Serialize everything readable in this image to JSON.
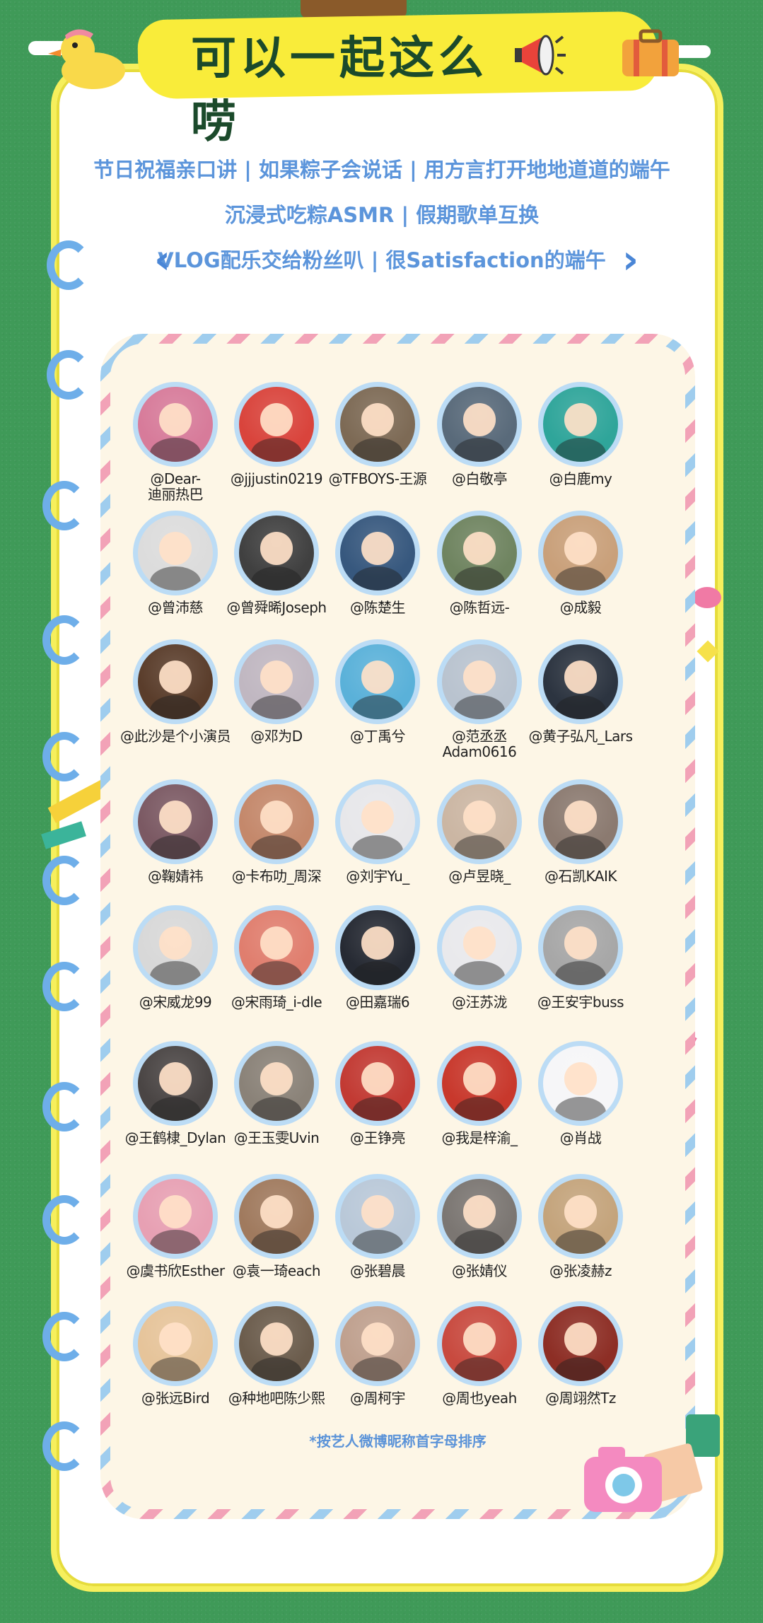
{
  "title": "可以一起这么唠",
  "topics": {
    "line1": "节日祝福亲口讲 | 如果粽子会说话 | 用方言打开地地道道的端午",
    "line2": "沉浸式吃粽ASMR | 假期歌单互换",
    "line3": "VLOG配乐交给粉丝叭 | 很Satisfaction的端午",
    "prev_icon": "‹",
    "next_icon": "›"
  },
  "artists": [
    {
      "name": "@Dear-\n迪丽热巴",
      "color": "#d77b9a"
    },
    {
      "name": "@jjjustin0219",
      "color": "#d9443c"
    },
    {
      "name": "@TFBOYS-王源",
      "color": "#7d6a55"
    },
    {
      "name": "@白敬亭",
      "color": "#596a7a"
    },
    {
      "name": "@白鹿my",
      "color": "#2fa59a"
    },
    {
      "name": "@曾沛慈",
      "color": "#dcdcdc"
    },
    {
      "name": "@曾舜晞Joseph",
      "color": "#404040"
    },
    {
      "name": "@陈楚生",
      "color": "#37587e"
    },
    {
      "name": "@陈哲远-",
      "color": "#6f8460"
    },
    {
      "name": "@成毅",
      "color": "#c9a07a"
    },
    {
      "name": "@此沙是个小演员",
      "color": "#5a3d2b"
    },
    {
      "name": "@邓为D",
      "color": "#c0b7c1"
    },
    {
      "name": "@丁禹兮",
      "color": "#5ab1d9"
    },
    {
      "name": "@范丞丞\nAdam0616",
      "color": "#b9c3cf"
    },
    {
      "name": "@黄子弘凡_Lars",
      "color": "#2c3440"
    },
    {
      "name": "@鞠婧祎",
      "color": "#7b5963"
    },
    {
      "name": "@卡布叻_周深",
      "color": "#c4886b"
    },
    {
      "name": "@刘宇Yu_",
      "color": "#e7e7ea"
    },
    {
      "name": "@卢昱晓_",
      "color": "#cbb6a3"
    },
    {
      "name": "@石凯KAIK",
      "color": "#8b7a70"
    },
    {
      "name": "@宋威龙99",
      "color": "#d8d8d8"
    },
    {
      "name": "@宋雨琦_i-dle",
      "color": "#e07e6e"
    },
    {
      "name": "@田嘉瑞6",
      "color": "#262a33"
    },
    {
      "name": "@汪苏泷",
      "color": "#e9e9ec"
    },
    {
      "name": "@王安宇buss",
      "color": "#a7a7a7"
    },
    {
      "name": "@王鹤棣_Dylan",
      "color": "#4a4544"
    },
    {
      "name": "@王玉雯Uvin",
      "color": "#8a8278"
    },
    {
      "name": "@王铮亮",
      "color": "#c23a33"
    },
    {
      "name": "@我是梓渝_",
      "color": "#c8382c"
    },
    {
      "name": "@肖战",
      "color": "#f6f6f8"
    },
    {
      "name": "@虞书欣Esther",
      "color": "#e7a0b3"
    },
    {
      "name": "@袁一琦each",
      "color": "#a07a5e"
    },
    {
      "name": "@张碧晨",
      "color": "#b9c8d8"
    },
    {
      "name": "@张婧仪",
      "color": "#7b7672"
    },
    {
      "name": "@张凌赫z",
      "color": "#c4a47c"
    },
    {
      "name": "@张远Bird",
      "color": "#e6c49a"
    },
    {
      "name": "@种地吧陈少熙",
      "color": "#6b5c4c"
    },
    {
      "name": "@周柯宇",
      "color": "#bfa08e"
    },
    {
      "name": "@周也yeah",
      "color": "#c84a3f"
    },
    {
      "name": "@周翊然Tz",
      "color": "#8d2e25"
    }
  ],
  "footnote": "*按艺人微博昵称首字母排序",
  "colors": {
    "background": "#3f9a58",
    "banner": "#f9ec3a",
    "title_text": "#1b4a2b",
    "topic_text": "#5c95db",
    "ring": "#6eaee9",
    "avatar_border": "#bcdcf5"
  },
  "icons": [
    "duck-icon",
    "megaphone-icon",
    "suitcase-icon",
    "camera-icon",
    "chevron-left-icon",
    "chevron-right-icon"
  ]
}
